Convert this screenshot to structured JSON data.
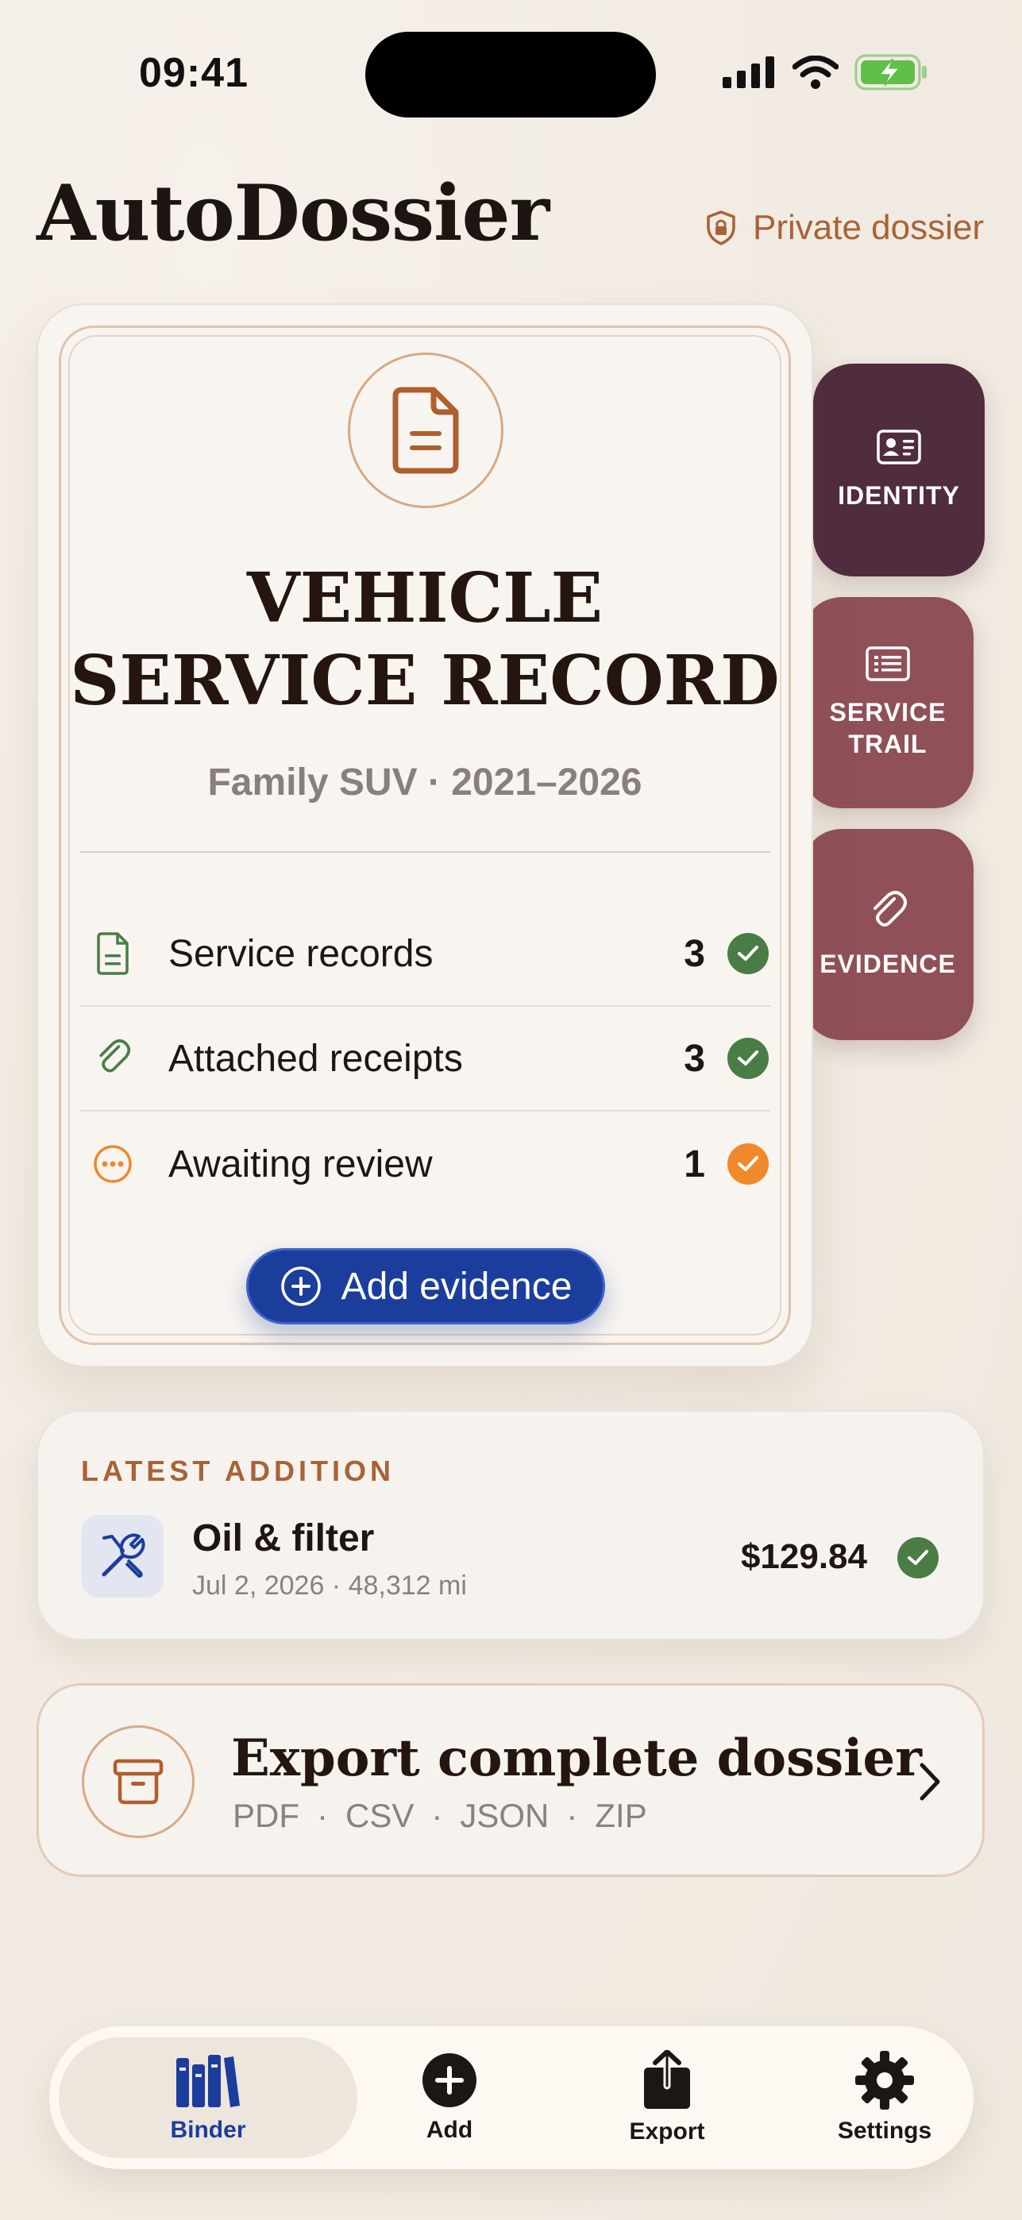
{
  "status_bar": {
    "time": "09:41"
  },
  "header": {
    "title": "AutoDossier",
    "privacy_label": "Private dossier"
  },
  "card": {
    "title_line1": "VEHICLE",
    "title_line2": "SERVICE RECORD",
    "subtitle": "Family SUV · 2021–2026",
    "rows": [
      {
        "label": "Service records",
        "count": "3",
        "status": "complete"
      },
      {
        "label": "Attached receipts",
        "count": "3",
        "status": "complete"
      },
      {
        "label": "Awaiting review",
        "count": "1",
        "status": "pending"
      }
    ],
    "add_button": "Add evidence"
  },
  "side_tabs": {
    "identity": "IDENTITY",
    "service_trail_line1": "SERVICE",
    "service_trail_line2": "TRAIL",
    "evidence": "EVIDENCE"
  },
  "latest": {
    "label": "LATEST ADDITION",
    "title": "Oil & filter",
    "meta": "Jul 2, 2026 · 48,312 mi",
    "amount": "$129.84"
  },
  "export": {
    "title": "Export complete dossier",
    "formats": [
      "PDF",
      "CSV",
      "JSON",
      "ZIP"
    ],
    "separator": "·"
  },
  "tabbar": {
    "binder": "Binder",
    "add": "Add",
    "export": "Export",
    "settings": "Settings",
    "active": "Binder"
  },
  "colors": {
    "accent_blue": "#1b3e9d",
    "accent_copper": "#a86335",
    "success_green": "#4a7d45",
    "pending_orange": "#f0892a",
    "tab_plum": "#4f2c3e",
    "tab_rose": "#8f5057"
  }
}
